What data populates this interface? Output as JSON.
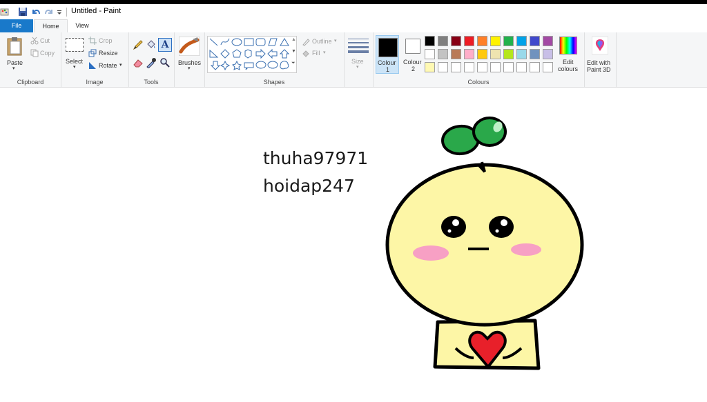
{
  "window": {
    "title": "Untitled - Paint"
  },
  "tabs": {
    "file": "File",
    "home": "Home",
    "view": "View"
  },
  "clipboard": {
    "paste": "Paste",
    "cut": "Cut",
    "copy": "Copy",
    "label": "Clipboard"
  },
  "image": {
    "select": "Select",
    "crop": "Crop",
    "resize": "Resize",
    "rotate": "Rotate",
    "label": "Image"
  },
  "tools": {
    "label": "Tools"
  },
  "brushes": {
    "label": "Brushes"
  },
  "shapes": {
    "outline": "Outline",
    "fill": "Fill",
    "label": "Shapes"
  },
  "size": {
    "label": "Size"
  },
  "colours": {
    "colour1_a": "Colour",
    "colour1_b": "1",
    "colour2_a": "Colour",
    "colour2_b": "2",
    "edit_a": "Edit",
    "edit_b": "colours",
    "label": "Colours",
    "colour1": "#000000",
    "colour2": "#ffffff",
    "palette_row1": [
      "#000000",
      "#7f7f7f",
      "#880015",
      "#ed1c24",
      "#ff7f27",
      "#fff200",
      "#22b14c",
      "#00a2e8",
      "#3f48cc",
      "#a349a4"
    ],
    "palette_row2": [
      "#ffffff",
      "#c3c3c3",
      "#b97a57",
      "#ffaec9",
      "#ffc90e",
      "#efe4b0",
      "#b5e61d",
      "#99d9ea",
      "#7092be",
      "#c8bfe7"
    ],
    "palette_row3": [
      "#fff9b3",
      "#ffffff",
      "#ffffff",
      "#ffffff",
      "#ffffff",
      "#ffffff",
      "#ffffff",
      "#ffffff",
      "#ffffff",
      "#ffffff"
    ]
  },
  "paint3d": {
    "a": "Edit with",
    "b": "Paint 3D"
  },
  "canvas": {
    "line1": "thuha97971",
    "line2": "hoidap247"
  }
}
